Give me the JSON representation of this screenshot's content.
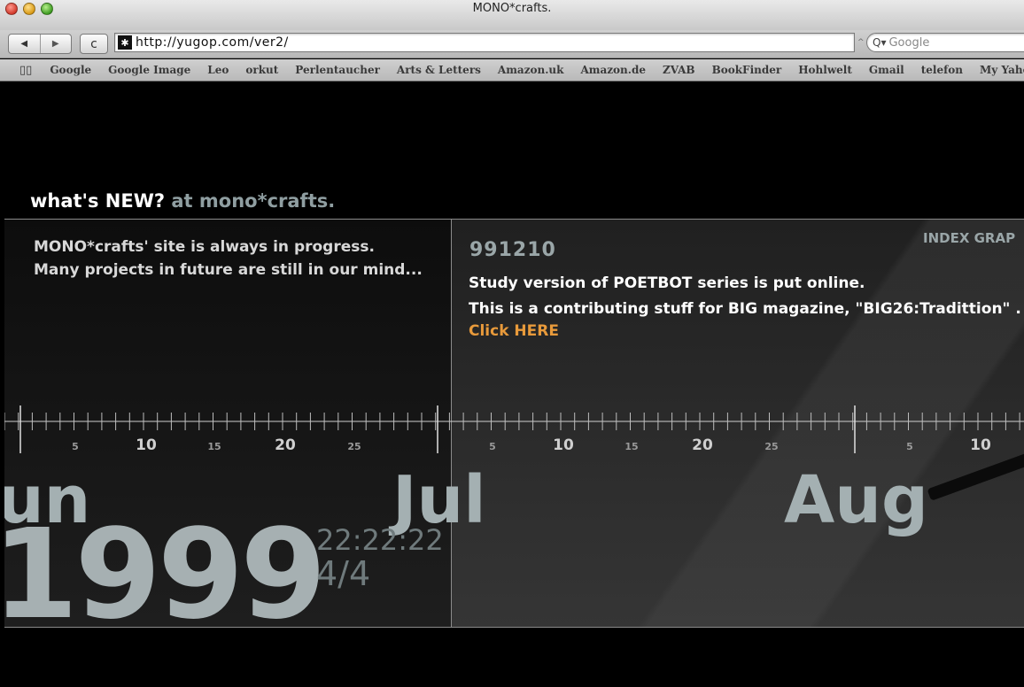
{
  "window": {
    "title": "MONO*crafts."
  },
  "toolbar": {
    "back_glyph": "◀",
    "forward_glyph": "▶",
    "reload_glyph": "c",
    "favicon_glyph": "✱",
    "url": "http://yugop.com/ver2/",
    "search_placeholder": "Google",
    "search_glyph": "Q▾",
    "snapback_glyph": "^"
  },
  "bookmarks": {
    "book_glyph": "▯▯",
    "items": [
      "Google",
      "Google Image",
      "Leo",
      "orkut",
      "Perlentaucher",
      "Arts & Letters",
      "Amazon.uk",
      "Amazon.de",
      "ZVAB",
      "BookFinder",
      "Hohlwelt",
      "Gmail",
      "telefon",
      "My Yaho"
    ]
  },
  "page": {
    "heading": "what's NEW?",
    "heading_accent": "at mono*crafts.",
    "intro_lines": [
      "MONO*crafts' site is always in progress.",
      "Many projects in future are still in our mind..."
    ],
    "news": {
      "id": "991210",
      "lines": [
        "Study version of POETBOT series is put online.",
        "This is a contributing stuff for BIG magazine, \"BIG26:Tradittion\" ."
      ],
      "link": "Click HERE"
    },
    "index_link": "INDEX GRAP",
    "ruler_labels": [
      "5",
      "10",
      "15",
      "20",
      "25",
      "5",
      "10",
      "15",
      "20",
      "25",
      "5",
      "10"
    ],
    "months": {
      "jun": "un",
      "jul": "Jul",
      "aug": "Aug"
    },
    "year": "1999",
    "time": "22:22:22",
    "fraction": "4/4"
  },
  "colors": {
    "accent_gray": "#8f9ea1",
    "link_orange": "#e89a3b",
    "month_gray": "#a4b0b2"
  }
}
